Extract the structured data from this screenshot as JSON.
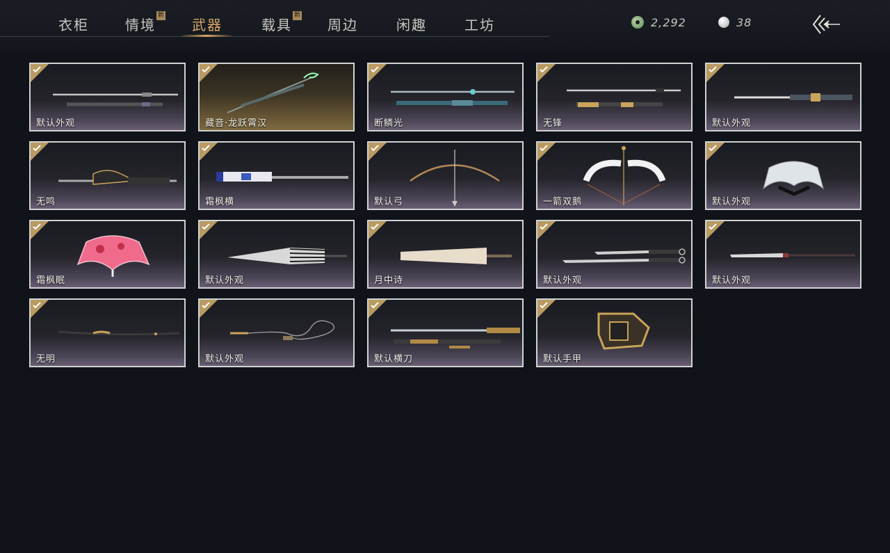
{
  "tabs": [
    {
      "label": "衣柜",
      "badge": ""
    },
    {
      "label": "情境",
      "badge": "新"
    },
    {
      "label": "武器",
      "badge": ""
    },
    {
      "label": "载具",
      "badge": "新"
    },
    {
      "label": "周边",
      "badge": ""
    },
    {
      "label": "闲趣",
      "badge": ""
    },
    {
      "label": "工坊",
      "badge": ""
    }
  ],
  "active_tab": "武器",
  "currency": {
    "jade": {
      "icon": "jade-coin-icon",
      "value": "2,292"
    },
    "pearl": {
      "icon": "pearl-icon",
      "value": "38"
    }
  },
  "back_icon": "back-arrow-icon",
  "colors": {
    "accent": "#d8a766",
    "check": "#b89a62",
    "border": "#d2d2d2"
  },
  "items": [
    {
      "label": "默认外观",
      "icon": "long-sword-icon"
    },
    {
      "label": "藏音·龙跃霄汉",
      "icon": "dragon-spear-icon"
    },
    {
      "label": "断鳞光",
      "icon": "jade-sword-icon"
    },
    {
      "label": "无锋",
      "icon": "sword-pair-icon"
    },
    {
      "label": "默认外观",
      "icon": "dual-blade-icon"
    },
    {
      "label": "无鸣",
      "icon": "ornate-blade-icon"
    },
    {
      "label": "霜枫横",
      "icon": "blue-blade-icon"
    },
    {
      "label": "默认弓",
      "icon": "bow-icon"
    },
    {
      "label": "一箭双鹅",
      "icon": "white-bow-icon"
    },
    {
      "label": "默认外观",
      "icon": "white-fan-icon"
    },
    {
      "label": "霜枫眠",
      "icon": "pink-fan-icon"
    },
    {
      "label": "默认外观",
      "icon": "striped-umbrella-icon"
    },
    {
      "label": "月中诗",
      "icon": "paper-umbrella-icon"
    },
    {
      "label": "默认外观",
      "icon": "twin-saber-icon"
    },
    {
      "label": "默认外观",
      "icon": "glaive-icon"
    },
    {
      "label": "无明",
      "icon": "staff-icon"
    },
    {
      "label": "默认外观",
      "icon": "rope-dart-icon"
    },
    {
      "label": "默认横刀",
      "icon": "straight-saber-icon"
    },
    {
      "label": "默认手甲",
      "icon": "gauntlet-icon"
    }
  ]
}
